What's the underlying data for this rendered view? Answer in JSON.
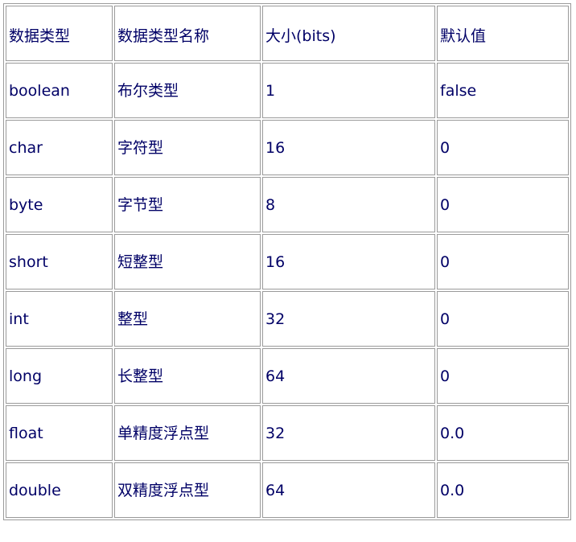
{
  "table": {
    "headers": [
      "数据类型",
      "数据类型名称",
      "大小(bits)",
      "默认值"
    ],
    "rows": [
      [
        "boolean",
        "布尔类型",
        "1",
        "false"
      ],
      [
        "char",
        "字符型",
        "16",
        "0"
      ],
      [
        "byte",
        "字节型",
        "8",
        "0"
      ],
      [
        "short",
        "短整型",
        "16",
        "0"
      ],
      [
        "int",
        "整型",
        "32",
        "0"
      ],
      [
        "long",
        "长整型",
        "64",
        "0"
      ],
      [
        "float",
        "单精度浮点型",
        "32",
        "0.0"
      ],
      [
        "double",
        "双精度浮点型",
        "64",
        "0.0"
      ]
    ]
  }
}
